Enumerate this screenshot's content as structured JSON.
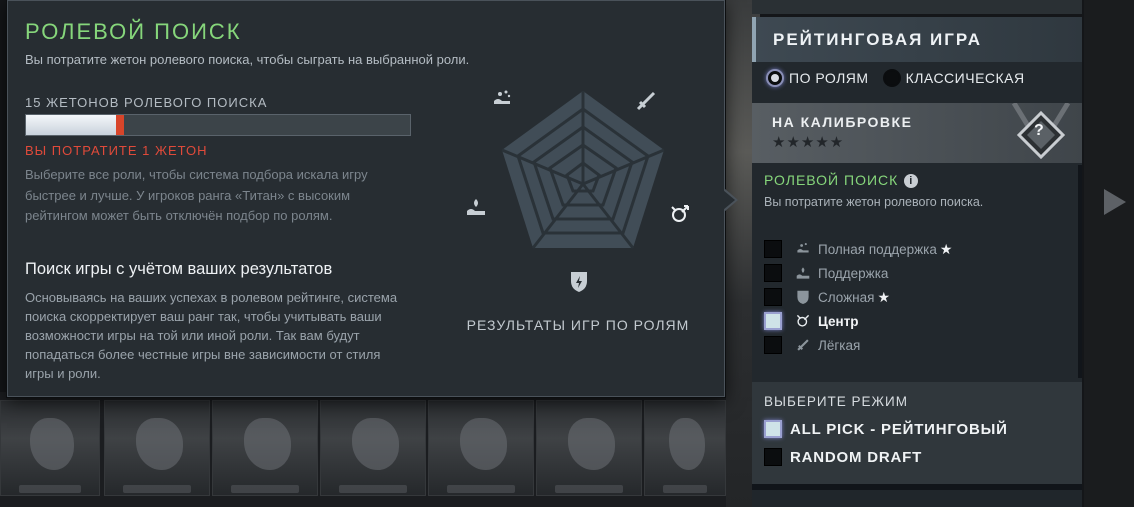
{
  "popup": {
    "title": "РОЛЕВОЙ ПОИСК",
    "subtitle": "Вы потратите жетон ролевого поиска, чтобы сыграть на выбранной роли.",
    "tokens_label": "15 ЖЕТОНОВ РОЛЕВОГО ПОИСКА",
    "token_fill_fraction": 0.235,
    "spend_text": "ВЫ ПОТРАТИТЕ 1 ЖЕТОН",
    "desc1": "Выберите все роли, чтобы система подбора искала игру быстрее и лучше. У игроков ранга «Титан» с высоким рейтингом может быть отключён подбор по ролям.",
    "heading2": "Поиск игры с учётом ваших результатов",
    "desc2": "Основываясь на ваших успехах в ролевом рейтинге, система поиска скорректирует ваш ранг так, чтобы учитывать ваши возможности игры на той или иной роли. Так вам будут попадаться более честные игры вне зависимости от стиля игры и роли.",
    "radar_caption": "РЕЗУЛЬТАТЫ ИГР ПО РОЛЯМ",
    "radar_icons": [
      "hard-support-icon",
      "soft-support-icon",
      "offlane-icon",
      "mid-icon",
      "carry-icon"
    ]
  },
  "panel": {
    "title": "РЕЙТИНГОВАЯ ИГРА",
    "mode_options": [
      {
        "label": "ПО РОЛЯМ",
        "selected": true
      },
      {
        "label": "КЛАССИЧЕСКАЯ",
        "selected": false
      }
    ],
    "calibration_label": "НА КАЛИБРОВКЕ",
    "calibration_stars": "★★★★★",
    "calibration_badge": "?",
    "role_search_title": "РОЛЕВОЙ ПОИСК",
    "role_search_info": "i",
    "role_search_sub": "Вы потратите жетон ролевого поиска.",
    "roles": [
      {
        "label": "Полная поддержка",
        "checked": false,
        "star": true,
        "icon": "hard-support-icon"
      },
      {
        "label": "Поддержка",
        "checked": false,
        "star": false,
        "icon": "soft-support-icon"
      },
      {
        "label": "Сложная",
        "checked": false,
        "star": true,
        "icon": "offlane-icon"
      },
      {
        "label": "Центр",
        "checked": true,
        "star": false,
        "icon": "mid-icon"
      },
      {
        "label": "Лёгкая",
        "checked": false,
        "star": false,
        "icon": "carry-icon"
      }
    ],
    "select_mode_title": "ВЫБЕРИТЕ РЕЖИМ",
    "game_modes": [
      {
        "label": "ALL PICK - РЕЙТИНГОВЫЙ",
        "checked": true
      },
      {
        "label": "RANDOM DRAFT",
        "checked": false
      }
    ]
  },
  "colors": {
    "accent_green": "#86d67b",
    "warning_red": "#e04a3a",
    "popup_bg": "#272d32",
    "radar_fill": "#414d57"
  }
}
